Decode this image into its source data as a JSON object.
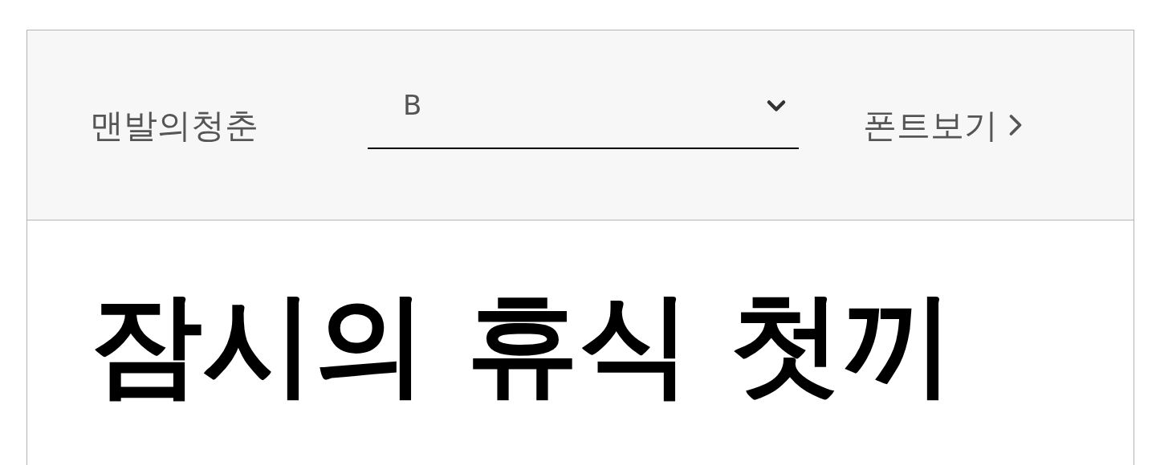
{
  "font_bar": {
    "font_name": "맨발의청춘",
    "weight_select": {
      "value": "B"
    },
    "view_link": "폰트보기"
  },
  "preview": {
    "text": "잠시의 휴식 첫끼"
  }
}
